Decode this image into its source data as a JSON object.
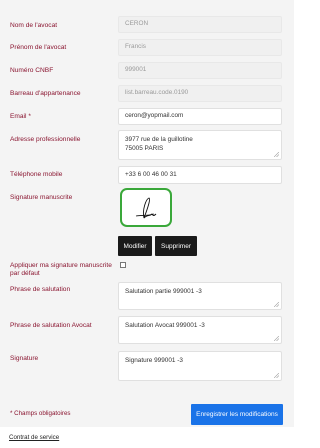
{
  "fields": {
    "nom_label": "Nom de l'avocat",
    "nom_value": "CERON",
    "prenom_label": "Prénom de l'avocat",
    "prenom_value": "Francis",
    "cnbf_label": "Numéro CNBF",
    "cnbf_value": "999001",
    "barreau_label": "Barreau d'appartenance",
    "barreau_value": "list.barreau.code.0190",
    "email_label": "Email *",
    "email_value": "ceron@yopmail.com",
    "adresse_label": "Adresse professionnelle",
    "adresse_value": "3977 rue de la guillotine\n75005 PARIS",
    "tel_label": "Téléphone mobile",
    "tel_value": "+33 6 00 46 00 31",
    "signature_label": "Signature manuscrite",
    "default_sig_label": "Appliquer ma signature manuscrite par défaut",
    "phrase_label": "Phrase de salutation",
    "phrase_value": "Salutation partie 999001 -3",
    "phrase_avocat_label": "Phrase de salutation Avocat",
    "phrase_avocat_value": "Salutation Avocat 999001 -3",
    "sign_label": "Signature",
    "sign_value": "Signature 999001 -3"
  },
  "buttons": {
    "modifier": "Modifier",
    "supprimer": "Supprimer",
    "save": "Enregistrer les modifications"
  },
  "footer": {
    "required_note": "* Champs obligatoires",
    "contract_link": "Contrat de service"
  },
  "colors": {
    "label": "#8a1530",
    "primary": "#1a73e8",
    "dark_button": "#1a1a1a",
    "signature_border": "#3aa83a"
  },
  "default_signature_checked": false
}
